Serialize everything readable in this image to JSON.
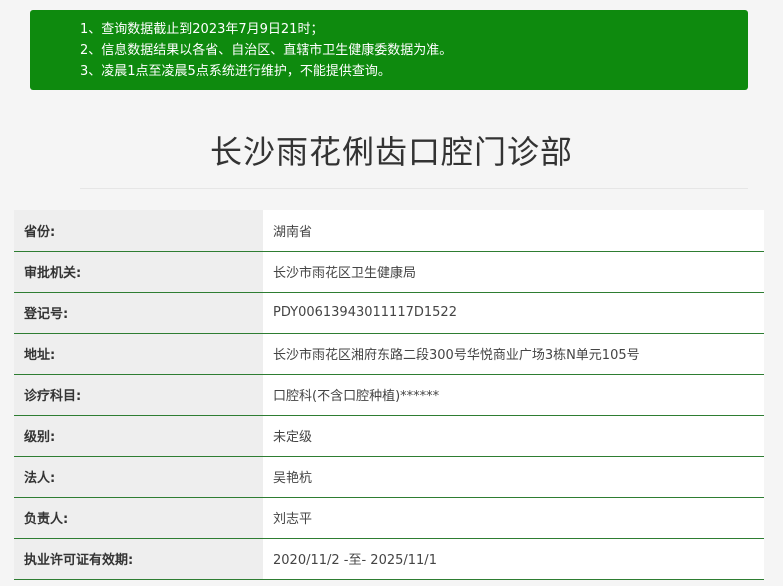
{
  "notice": {
    "lines": [
      "1、查询数据截止到2023年7月9日21时；",
      "2、信息数据结果以各省、自治区、直辖市卫生健康委数据为准。",
      "3、凌晨1点至凌晨5点系统进行维护，不能提供查询。"
    ]
  },
  "page": {
    "title": "长沙雨花俐齿口腔门诊部"
  },
  "info_rows": [
    {
      "label": "省份:",
      "value": "湖南省"
    },
    {
      "label": "审批机关:",
      "value": "长沙市雨花区卫生健康局"
    },
    {
      "label": "登记号:",
      "value": "PDY00613943011117D1522"
    },
    {
      "label": "地址:",
      "value": "长沙市雨花区湘府东路二段300号华悦商业广场3栋N单元105号"
    },
    {
      "label": "诊疗科目:",
      "value": "口腔科(不含口腔种植)******"
    },
    {
      "label": "级别:",
      "value": "未定级"
    },
    {
      "label": "法人:",
      "value": "吴艳杭"
    },
    {
      "label": "负责人:",
      "value": "刘志平"
    },
    {
      "label": "执业许可证有效期:",
      "value": "2020/11/2 -至- 2025/11/1"
    }
  ],
  "colors": {
    "notice_bg": "#0e8a0e",
    "row_border": "#2e7d32"
  }
}
